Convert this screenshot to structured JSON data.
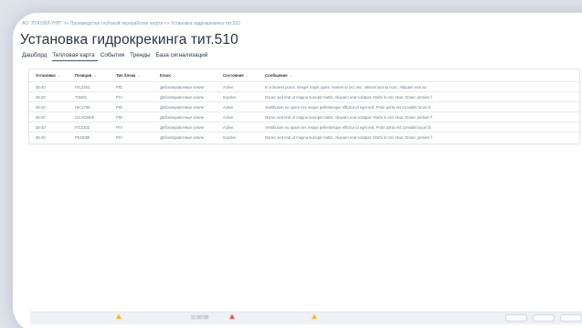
{
  "breadcrumb": "АО \"ЛУКОЙЛ-УНП\" >> Производство глубокой переработки нефти >> Установка гидрокрекинга тит.510",
  "title": "Установка гидрокрекинга тит.510",
  "tabs": [
    {
      "label": "Дашборд",
      "active": false
    },
    {
      "label": "Тепловая карта",
      "active": true
    },
    {
      "label": "События",
      "active": false
    },
    {
      "label": "Тренды",
      "active": false
    },
    {
      "label": "База сигнализаций",
      "active": false
    }
  ],
  "table": {
    "sort_icon": "chevron-down-icon",
    "columns": [
      "Установка",
      "Позиция",
      "Тип блока",
      "Класс",
      "Состояние",
      "Сообщение"
    ],
    "rows": [
      [
        "36-20",
        "PIC2303",
        "PID",
        "Дебоклировочные ключи",
        "Active",
        "In a laoreet purus. Integer turpis quam, laoreet id orci nec, ultrices lacinia nunc. Aliquam erat va"
      ],
      [
        "36-20",
        "TI3401",
        "PVI",
        "Дебоклировочные ключи",
        "Inactive",
        "Donec sed erat ut magna suscipit mattis. Aliquam erat volutpat. Morbi in orci risus. Donec pretium f"
      ],
      [
        "36-20",
        "HIC1706",
        "PID",
        "Дебоклировочные ключи",
        "Active",
        "Vestibulum eu quam nec neque pellentesque efficitur id eget nisl. Proin porta est convallis lacus bl"
      ],
      [
        "36-20",
        "LICA02405",
        "PID",
        "Дебоклировочные ключи",
        "Active",
        "Donec sed erat ut magna suscipit mattis. Aliquam erat volutpat. Morbi in orci risus. Donec pretium f"
      ],
      [
        "36-20",
        "FIC2102",
        "PVI",
        "Дебоклировочные ключи",
        "Active",
        "Vestibulum eu quam nec neque pellentesque efficitur id eget nisl. Proin porta est convallis lacus bl"
      ],
      [
        "36-20",
        "PDI2088",
        "PVI",
        "Дебоклировочные ключи",
        "Inactive",
        "Donec sed erat ut magna suscipit mattis. Aliquam erat volutpat. Morbi in orci risus. Donec pretium f"
      ]
    ]
  },
  "footer": {
    "time": "11:50:08"
  },
  "colors": {
    "title": "#2b3340",
    "warning_yellow": "#f0b400",
    "warning_red": "#e0453a"
  }
}
